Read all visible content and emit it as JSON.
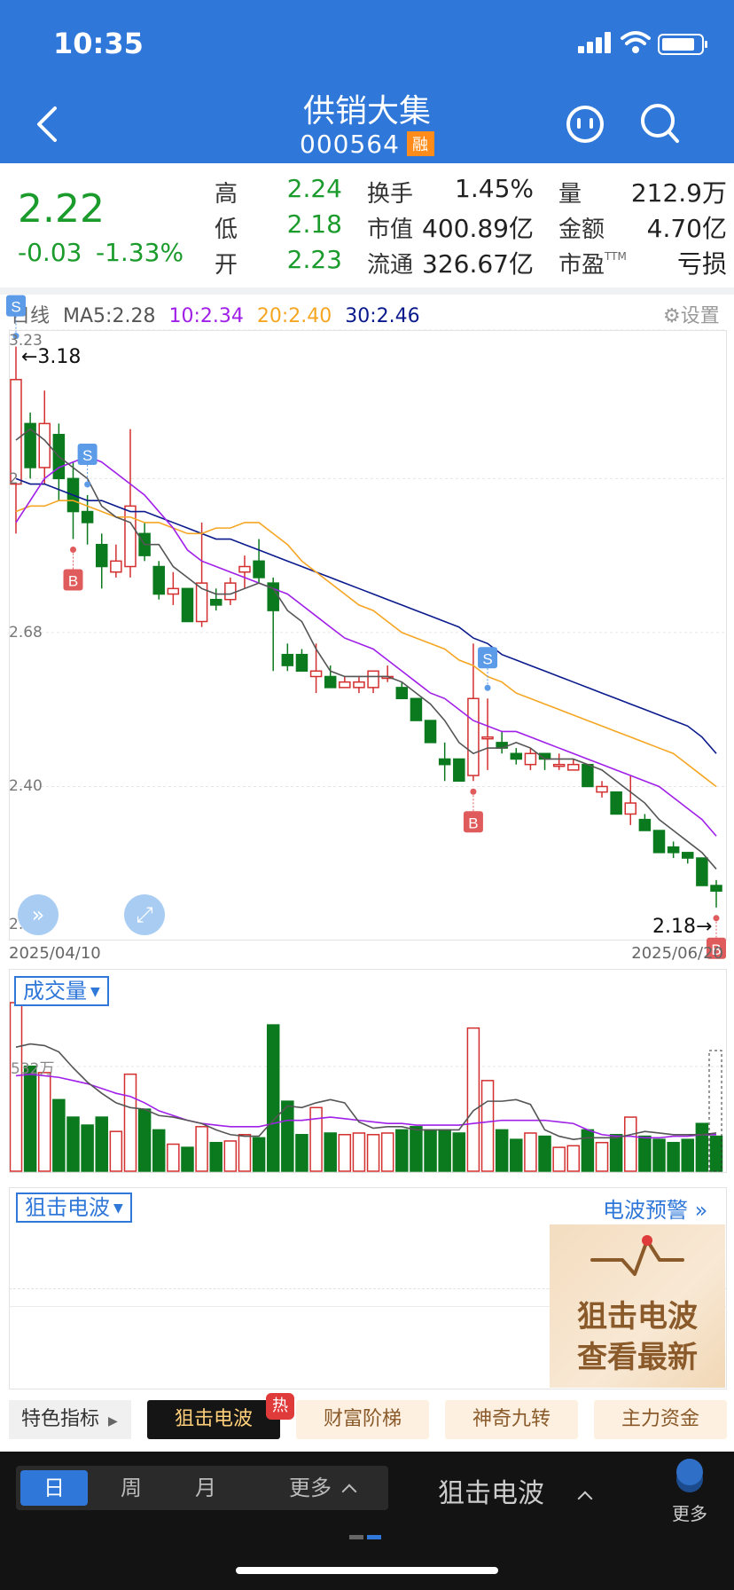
{
  "status_bar": {
    "time": "10:35"
  },
  "header": {
    "stock_name": "供销大集",
    "stock_code": "000564",
    "badge": "融"
  },
  "quote": {
    "price": "2.22",
    "change": "-0.03",
    "change_pct": "-1.33%",
    "fields": [
      {
        "label": "高",
        "value": "2.24",
        "tone": "green"
      },
      {
        "label": "低",
        "value": "2.18",
        "tone": "green"
      },
      {
        "label": "开",
        "value": "2.23",
        "tone": "green"
      },
      {
        "label": "换手",
        "value": "1.45%",
        "tone": "dark"
      },
      {
        "label": "市值",
        "value": "400.89亿",
        "tone": "dark"
      },
      {
        "label": "流通",
        "value": "326.67亿",
        "tone": "dark"
      },
      {
        "label": "量",
        "value": "212.9万",
        "tone": "dark"
      },
      {
        "label": "金额",
        "value": "4.70亿",
        "tone": "dark"
      },
      {
        "label": "市盈",
        "label_sup": "TTM",
        "value": "亏损",
        "tone": "dark"
      }
    ]
  },
  "ma_legend": {
    "period": "日线",
    "ma5": "MA5:2.28",
    "ma10": "10:2.34",
    "ma20": "20:2.40",
    "ma30": "30:2.46",
    "colors": {
      "ma5": "#555555",
      "ma10": "#a020e8",
      "ma20": "#f5a623",
      "ma30": "#0a1a8c"
    }
  },
  "settings_label": "设置",
  "chart": {
    "y_axis_labels": [
      "3.23",
      "2.",
      "2.68",
      "2.40",
      "2.1"
    ],
    "high_marker": "←3.18",
    "low_marker": "2.18→",
    "start_date": "2025/04/10",
    "end_date": "2025/06/20",
    "signal_labels": {
      "buy": "B",
      "sell": "S"
    }
  },
  "chart_data": {
    "type": "candlestick",
    "ylim": [
      2.12,
      3.23
    ],
    "candles": [
      [
        2.95,
        3.14,
        2.86,
        3.2
      ],
      [
        3.06,
        2.98,
        2.96,
        3.08
      ],
      [
        2.98,
        3.06,
        2.95,
        3.12
      ],
      [
        3.04,
        2.96,
        2.92,
        3.06
      ],
      [
        2.96,
        2.9,
        2.85,
        2.99
      ],
      [
        2.9,
        2.88,
        2.84,
        2.93
      ],
      [
        2.84,
        2.8,
        2.76,
        2.86
      ],
      [
        2.79,
        2.81,
        2.78,
        2.84
      ],
      [
        2.8,
        2.91,
        2.78,
        3.05
      ],
      [
        2.86,
        2.82,
        2.81,
        2.88
      ],
      [
        2.8,
        2.75,
        2.74,
        2.81
      ],
      [
        2.75,
        2.76,
        2.73,
        2.79
      ],
      [
        2.76,
        2.7,
        2.7,
        2.76
      ],
      [
        2.7,
        2.77,
        2.69,
        2.88
      ],
      [
        2.74,
        2.73,
        2.72,
        2.76
      ],
      [
        2.74,
        2.77,
        2.73,
        2.78
      ],
      [
        2.79,
        2.8,
        2.76,
        2.82
      ],
      [
        2.81,
        2.78,
        2.77,
        2.85
      ],
      [
        2.77,
        2.72,
        2.61,
        2.78
      ],
      [
        2.64,
        2.62,
        2.61,
        2.66
      ],
      [
        2.64,
        2.61,
        2.61,
        2.65
      ],
      [
        2.6,
        2.61,
        2.57,
        2.66
      ],
      [
        2.6,
        2.58,
        2.58,
        2.62
      ],
      [
        2.58,
        2.59,
        2.58,
        2.6
      ],
      [
        2.58,
        2.59,
        2.57,
        2.6
      ],
      [
        2.58,
        2.61,
        2.57,
        2.61
      ],
      [
        2.6,
        2.6,
        2.59,
        2.62
      ],
      [
        2.58,
        2.56,
        2.56,
        2.59
      ],
      [
        2.56,
        2.52,
        2.52,
        2.56
      ],
      [
        2.52,
        2.48,
        2.48,
        2.52
      ],
      [
        2.45,
        2.44,
        2.41,
        2.48
      ],
      [
        2.45,
        2.41,
        2.41,
        2.45
      ],
      [
        2.42,
        2.56,
        2.41,
        2.66
      ],
      [
        2.49,
        2.49,
        2.43,
        2.56
      ],
      [
        2.48,
        2.47,
        2.46,
        2.5
      ],
      [
        2.46,
        2.45,
        2.44,
        2.47
      ],
      [
        2.44,
        2.46,
        2.43,
        2.47
      ],
      [
        2.46,
        2.45,
        2.43,
        2.46
      ],
      [
        2.44,
        2.44,
        2.43,
        2.46
      ],
      [
        2.43,
        2.44,
        2.43,
        2.45
      ],
      [
        2.44,
        2.4,
        2.4,
        2.44
      ],
      [
        2.39,
        2.4,
        2.38,
        2.41
      ],
      [
        2.39,
        2.35,
        2.35,
        2.39
      ],
      [
        2.35,
        2.37,
        2.33,
        2.42
      ],
      [
        2.34,
        2.32,
        2.32,
        2.35
      ],
      [
        2.32,
        2.28,
        2.28,
        2.32
      ],
      [
        2.29,
        2.28,
        2.27,
        2.3
      ],
      [
        2.28,
        2.27,
        2.26,
        2.28
      ],
      [
        2.27,
        2.22,
        2.22,
        2.27
      ],
      [
        2.22,
        2.21,
        2.18,
        2.23
      ]
    ],
    "ma5": [
      3.03,
      3.05,
      3.03,
      3.0,
      2.98,
      2.96,
      2.91,
      2.89,
      2.88,
      2.84,
      2.84,
      2.8,
      2.78,
      2.76,
      2.75,
      2.75,
      2.76,
      2.77,
      2.76,
      2.72,
      2.7,
      2.65,
      2.61,
      2.6,
      2.6,
      2.6,
      2.6,
      2.59,
      2.57,
      2.55,
      2.52,
      2.48,
      2.46,
      2.47,
      2.47,
      2.48,
      2.47,
      2.45,
      2.45,
      2.45,
      2.44,
      2.43,
      2.41,
      2.39,
      2.37,
      2.34,
      2.32,
      2.3,
      2.28,
      2.25
    ],
    "ma10": [
      2.88,
      2.92,
      2.96,
      2.98,
      2.99,
      3.0,
      2.99,
      2.97,
      2.95,
      2.93,
      2.9,
      2.87,
      2.83,
      2.81,
      2.8,
      2.79,
      2.78,
      2.77,
      2.76,
      2.75,
      2.73,
      2.71,
      2.69,
      2.67,
      2.66,
      2.65,
      2.63,
      2.61,
      2.59,
      2.57,
      2.56,
      2.54,
      2.52,
      2.51,
      2.5,
      2.5,
      2.49,
      2.48,
      2.47,
      2.46,
      2.45,
      2.44,
      2.43,
      2.42,
      2.41,
      2.4,
      2.38,
      2.36,
      2.34,
      2.31
    ],
    "ma20": [
      2.9,
      2.91,
      2.91,
      2.92,
      2.92,
      2.91,
      2.9,
      2.89,
      2.89,
      2.88,
      2.88,
      2.87,
      2.86,
      2.86,
      2.87,
      2.87,
      2.88,
      2.88,
      2.86,
      2.84,
      2.81,
      2.79,
      2.77,
      2.75,
      2.73,
      2.72,
      2.7,
      2.68,
      2.67,
      2.66,
      2.65,
      2.63,
      2.62,
      2.6,
      2.59,
      2.57,
      2.56,
      2.55,
      2.54,
      2.53,
      2.52,
      2.51,
      2.5,
      2.49,
      2.48,
      2.47,
      2.46,
      2.44,
      2.42,
      2.4
    ],
    "ma30": [
      2.96,
      2.95,
      2.95,
      2.94,
      2.93,
      2.92,
      2.92,
      2.91,
      2.9,
      2.9,
      2.89,
      2.88,
      2.87,
      2.86,
      2.85,
      2.85,
      2.84,
      2.83,
      2.82,
      2.81,
      2.8,
      2.79,
      2.78,
      2.77,
      2.76,
      2.75,
      2.74,
      2.73,
      2.72,
      2.71,
      2.7,
      2.69,
      2.67,
      2.66,
      2.64,
      2.63,
      2.62,
      2.61,
      2.6,
      2.59,
      2.58,
      2.57,
      2.56,
      2.55,
      2.54,
      2.53,
      2.52,
      2.51,
      2.49,
      2.46
    ],
    "signals": [
      {
        "index": 0,
        "type": "sell"
      },
      {
        "index": 5,
        "type": "sell"
      },
      {
        "index": 4,
        "type": "buy"
      },
      {
        "index": 32,
        "type": "buy"
      },
      {
        "index": 33,
        "type": "sell"
      },
      {
        "index": 49,
        "type": "buy"
      }
    ],
    "volume": {
      "ylabel": "532万",
      "values": [
        10.6,
        6.6,
        6.2,
        4.5,
        3.4,
        2.9,
        3.4,
        2.5,
        6.1,
        3.9,
        2.6,
        1.7,
        1.5,
        2.8,
        1.8,
        1.9,
        2.3,
        2.1,
        9.2,
        4.4,
        2.3,
        4.0,
        2.4,
        2.3,
        2.4,
        2.3,
        2.4,
        2.6,
        2.8,
        2.6,
        2.6,
        2.4,
        9.0,
        5.7,
        2.6,
        2.0,
        2.4,
        2.2,
        1.5,
        1.6,
        2.6,
        1.8,
        2.3,
        3.4,
        2.2,
        2.0,
        1.8,
        2.0,
        3.0,
        2.2
      ],
      "ma5": [
        7.8,
        8.0,
        7.9,
        7.5,
        6.5,
        5.6,
        4.9,
        4.3,
        4.0,
        3.9,
        3.5,
        3.4,
        3.2,
        3.0,
        2.6,
        2.3,
        2.2,
        2.2,
        3.2,
        4.1,
        4.0,
        4.3,
        4.5,
        4.3,
        3.1,
        2.7,
        2.8,
        2.8,
        2.6,
        2.6,
        2.6,
        2.6,
        3.8,
        4.4,
        4.4,
        4.5,
        4.2,
        2.6,
        2.2,
        2.0,
        2.1,
        2.1,
        2.1,
        2.3,
        2.5,
        2.4,
        2.3,
        2.3,
        2.3,
        2.4
      ],
      "ma10": [
        6.0,
        6.1,
        6.0,
        5.9,
        5.7,
        5.5,
        5.2,
        4.9,
        4.7,
        4.3,
        3.8,
        3.5,
        3.2,
        3.0,
        2.9,
        2.8,
        2.8,
        2.8,
        3.0,
        3.2,
        3.2,
        3.3,
        3.4,
        3.3,
        3.2,
        3.1,
        3.0,
        3.0,
        2.9,
        2.9,
        2.9,
        2.9,
        3.0,
        3.1,
        3.2,
        3.2,
        3.2,
        3.2,
        3.1,
        3.0,
        2.6,
        2.3,
        2.2,
        2.2,
        2.1,
        2.1,
        2.2,
        2.2,
        2.3,
        2.3
      ],
      "max": 10.6,
      "up_color": "#d32f2f",
      "down_color": "#0b7a1e"
    }
  },
  "volume_panel": {
    "selector": "成交量",
    "y_label": "532万"
  },
  "wave_panel": {
    "selector": "狙击电波",
    "warning_link": "电波预警",
    "promo_line1": "狙击电波",
    "promo_line2": "查看最新"
  },
  "indicator_tabs": {
    "special": "特色指标",
    "active": "狙击电波",
    "hot_badge": "热",
    "others": [
      "财富阶梯",
      "神奇九转",
      "主力资金"
    ]
  },
  "bottom_bar": {
    "periods": [
      "日",
      "周",
      "月",
      "更多"
    ],
    "active_period": "日",
    "indicator_select": "狙击电波",
    "more_label": "更多"
  }
}
